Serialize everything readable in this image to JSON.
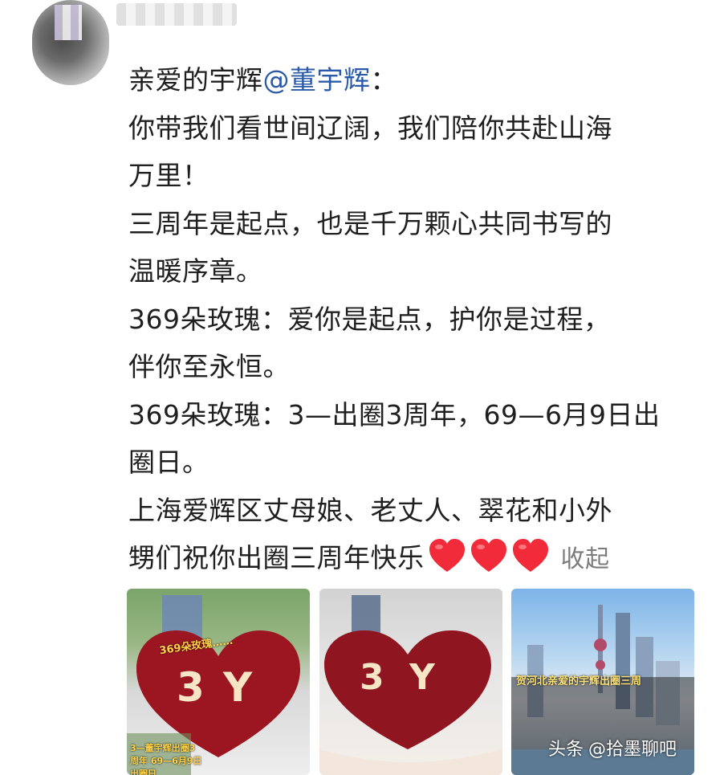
{
  "post": {
    "line1_prefix": "亲爱的宇辉",
    "mention": "@董宇辉",
    "line1_suffix": "：",
    "line2": "你带我们看世间辽阔，我们陪你共赴山海",
    "line3": "万里！",
    "line4": "三周年是起点，也是千万颗心共同书写的",
    "line5": "温暖序章。",
    "line6": " 369朵玫瑰：爱你是起点，护你是过程，",
    "line7": "伴你至永恒。",
    "line8": "369朵玫瑰：3—出圈3周年，69—6月9日出",
    "line9": "圈日。",
    "line10": " 上海爱辉区丈母娘、老丈人、翠花和小外",
    "line11": "甥们祝你出圈三周年快乐",
    "collapse_label": "收起",
    "hearts": [
      "heart-emoji",
      "heart-emoji",
      "heart-emoji"
    ],
    "heart_color": "#f22b3a"
  },
  "images": {
    "thumb1_caption": "369朵玫瑰……",
    "thumb1_bottom": "3—董宇辉出圈3周年 69—6月9日出圈日",
    "thumb3_caption": "贺河北亲爱的宇辉出圈三周"
  },
  "watermark": {
    "platform": "头条",
    "account": "@拾墨聊吧"
  }
}
